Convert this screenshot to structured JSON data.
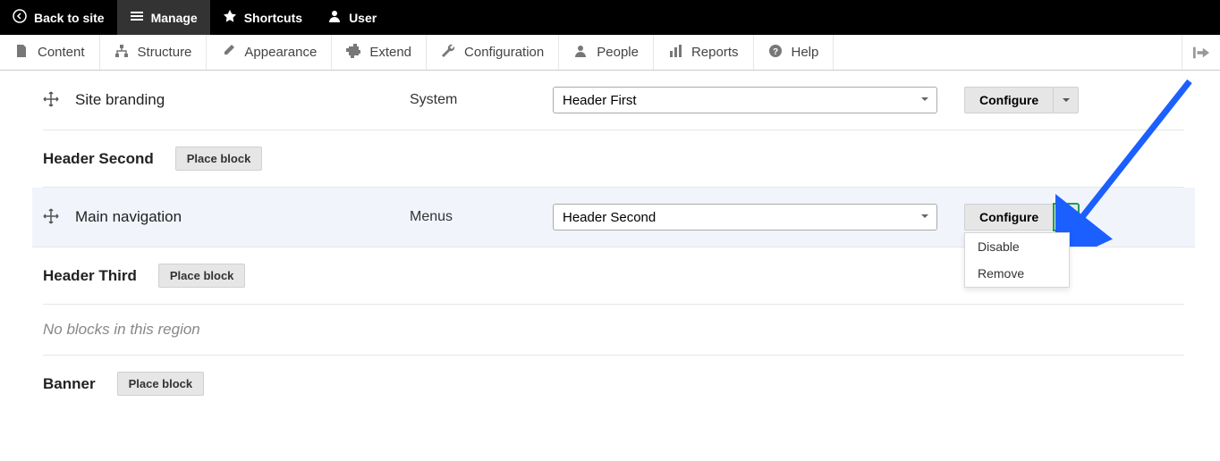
{
  "topbar": {
    "back": "Back to site",
    "manage": "Manage",
    "shortcuts": "Shortcuts",
    "user": "User"
  },
  "adminmenu": {
    "content": "Content",
    "structure": "Structure",
    "appearance": "Appearance",
    "extend": "Extend",
    "configuration": "Configuration",
    "people": "People",
    "reports": "Reports",
    "help": "Help"
  },
  "labels": {
    "place_block": "Place block",
    "configure": "Configure",
    "no_blocks": "No blocks in this region"
  },
  "dropdown": {
    "disable": "Disable",
    "remove": "Remove"
  },
  "blocks": {
    "site_branding": {
      "title": "Site branding",
      "category": "System",
      "region": "Header First"
    },
    "main_nav": {
      "title": "Main navigation",
      "category": "Menus",
      "region": "Header Second"
    }
  },
  "regions": {
    "header_second": "Header Second",
    "header_third": "Header Third",
    "banner": "Banner"
  }
}
